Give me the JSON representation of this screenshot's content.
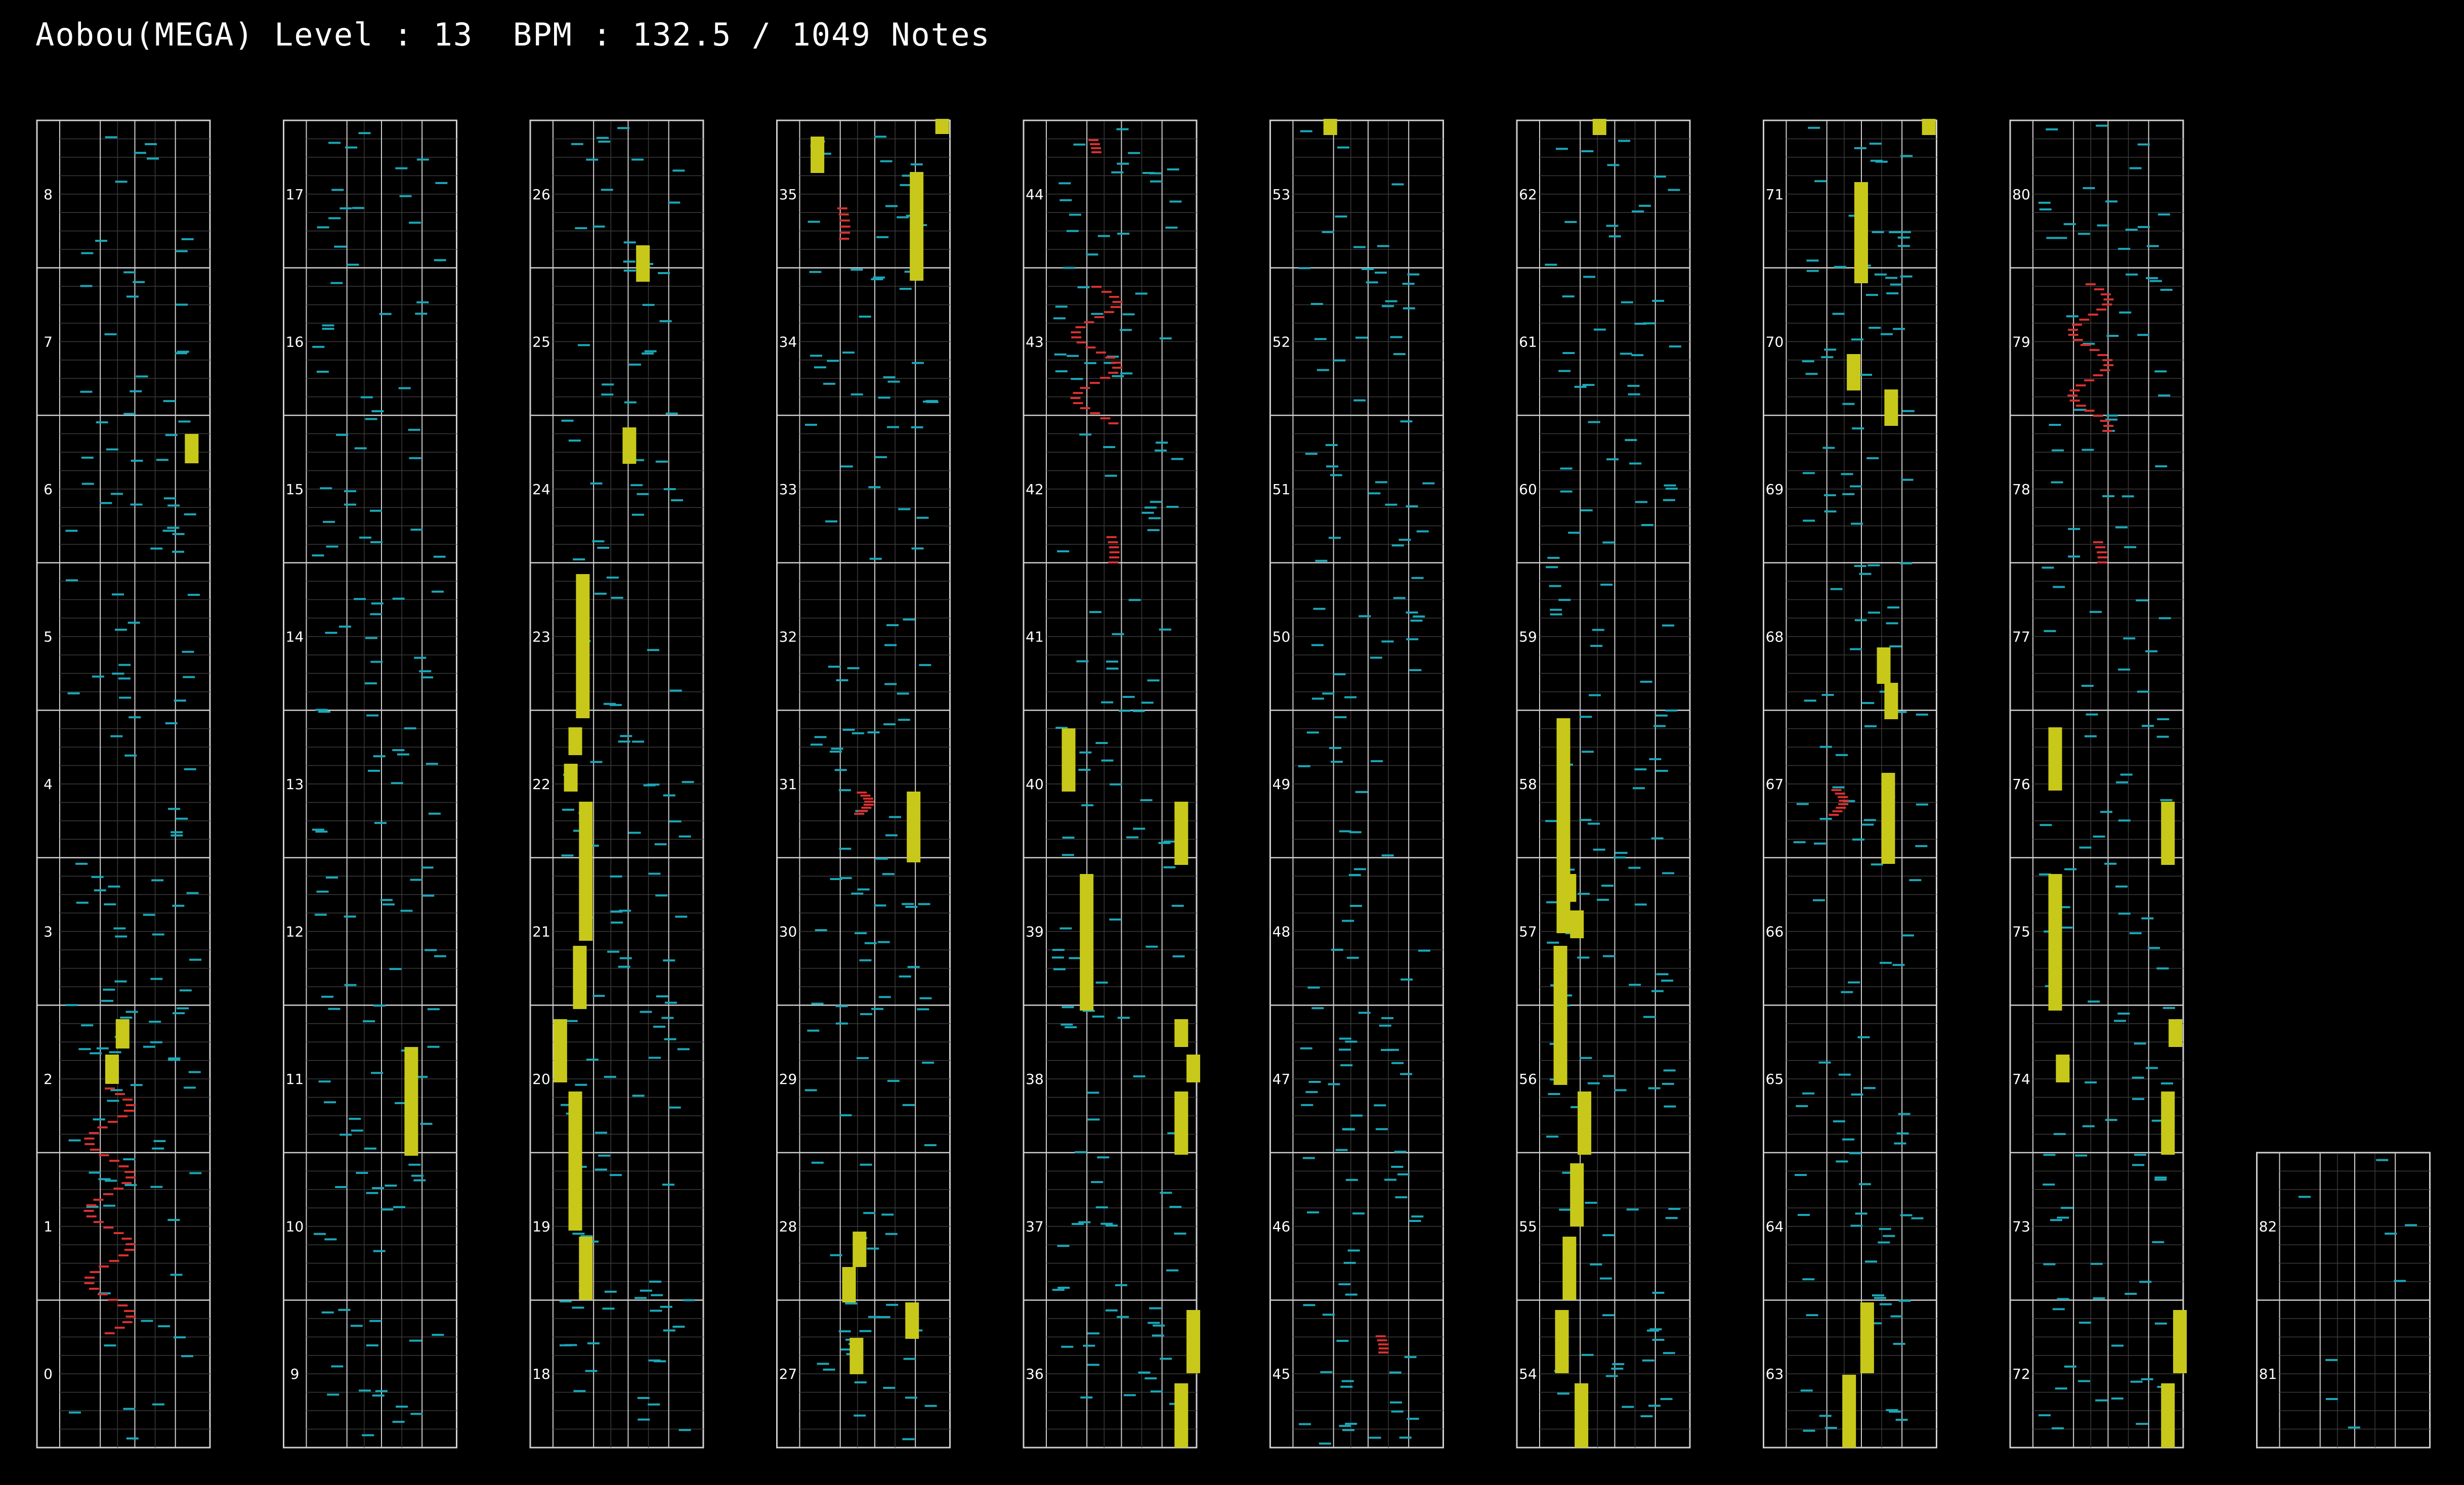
{
  "header": {
    "song": "Aobou(MEGA)",
    "level_label": "Level :",
    "level": "13",
    "bpm_label": "BPM :",
    "bpm": "132.5",
    "separator": "/",
    "notes": "1049",
    "notes_label": "Notes"
  },
  "colors": {
    "background": "#000000",
    "frame": "#cfcfcf",
    "grid": "#3a3a3a",
    "tap_note": "#1aa8b8",
    "long_note": "#c8c81a",
    "slide_note": "#d83030"
  },
  "chart_data": {
    "type": "rhythm-game-chart",
    "columns": 10,
    "measures_per_column": 9,
    "column_measure_labels": [
      [
        "8",
        "7",
        "6",
        "5",
        "4",
        "3",
        "2",
        "1",
        "0"
      ],
      [
        "17",
        "16",
        "15",
        "14",
        "13",
        "12",
        "11",
        "10",
        "9"
      ],
      [
        "26",
        "25",
        "24",
        "23",
        "22",
        "21",
        "20",
        "19",
        "18"
      ],
      [
        "35",
        "34",
        "33",
        "32",
        "31",
        "30",
        "29",
        "28",
        "27"
      ],
      [
        "44",
        "43",
        "42",
        "41",
        "40",
        "39",
        "38",
        "37",
        "36"
      ],
      [
        "53",
        "52",
        "51",
        "50",
        "49",
        "48",
        "47",
        "46",
        "45"
      ],
      [
        "62",
        "61",
        "60",
        "59",
        "58",
        "57",
        "56",
        "55",
        "54"
      ],
      [
        "71",
        "70",
        "69",
        "68",
        "67",
        "66",
        "65",
        "64",
        "63"
      ],
      [
        "80",
        "79",
        "78",
        "77",
        "76",
        "75",
        "74",
        "73",
        "72"
      ],
      [
        "82",
        "81"
      ]
    ]
  }
}
